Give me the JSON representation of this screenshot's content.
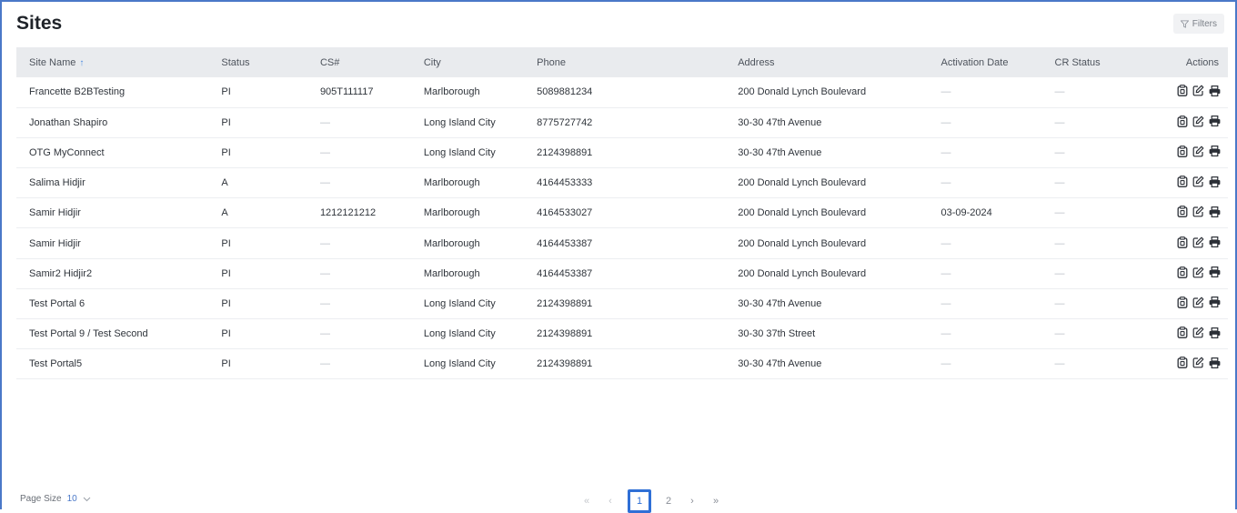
{
  "page": {
    "title": "Sites",
    "filters_label": "Filters"
  },
  "table": {
    "headers": [
      "Site Name",
      "Status",
      "CS#",
      "City",
      "Phone",
      "Address",
      "Activation Date",
      "CR Status",
      "Actions"
    ],
    "rows": [
      [
        "Francette B2BTesting",
        "PI",
        "905T111117",
        "Marlborough",
        "5089881234",
        "200 Donald Lynch Boulevard",
        "—",
        "—"
      ],
      [
        "Jonathan Shapiro",
        "PI",
        "—",
        "Long Island City",
        "8775727742",
        "30-30 47th Avenue",
        "—",
        "—"
      ],
      [
        "OTG MyConnect",
        "PI",
        "—",
        "Long Island City",
        "2124398891",
        "30-30 47th Avenue",
        "—",
        "—"
      ],
      [
        "Salima Hidjir",
        "A",
        "—",
        "Marlborough",
        "4164453333",
        "200 Donald Lynch Boulevard",
        "—",
        "—"
      ],
      [
        "Samir Hidjir",
        "A",
        "1212121212",
        "Marlborough",
        "4164533027",
        "200 Donald Lynch Boulevard",
        "03-09-2024",
        "—"
      ],
      [
        "Samir Hidjir",
        "PI",
        "—",
        "Marlborough",
        "4164453387",
        "200 Donald Lynch Boulevard",
        "—",
        "—"
      ],
      [
        "Samir2 Hidjir2",
        "PI",
        "—",
        "Marlborough",
        "4164453387",
        "200 Donald Lynch Boulevard",
        "—",
        "—"
      ],
      [
        "Test Portal 6",
        "PI",
        "—",
        "Long Island City",
        "2124398891",
        "30-30 47th Avenue",
        "—",
        "—"
      ],
      [
        "Test Portal 9 / Test Second",
        "PI",
        "—",
        "Long Island City",
        "2124398891",
        "30-30 37th Street",
        "—",
        "—"
      ],
      [
        "Test Portal5",
        "PI",
        "—",
        "Long Island City",
        "2124398891",
        "30-30 47th Avenue",
        "—",
        "—"
      ]
    ],
    "row_action_icons": [
      "clipboard-icon",
      "edit-icon",
      "print-icon"
    ]
  },
  "footer": {
    "page_size_label": "Page Size",
    "page_size_value": "10",
    "pages": [
      "1",
      "2"
    ],
    "current_page": "1",
    "nav": {
      "first": "«",
      "prev": "‹",
      "next": "›",
      "last": "»"
    }
  },
  "colors": {
    "accent": "#2f6fd6",
    "frame": "#4a78c8",
    "header_bg": "#e9ebee"
  }
}
